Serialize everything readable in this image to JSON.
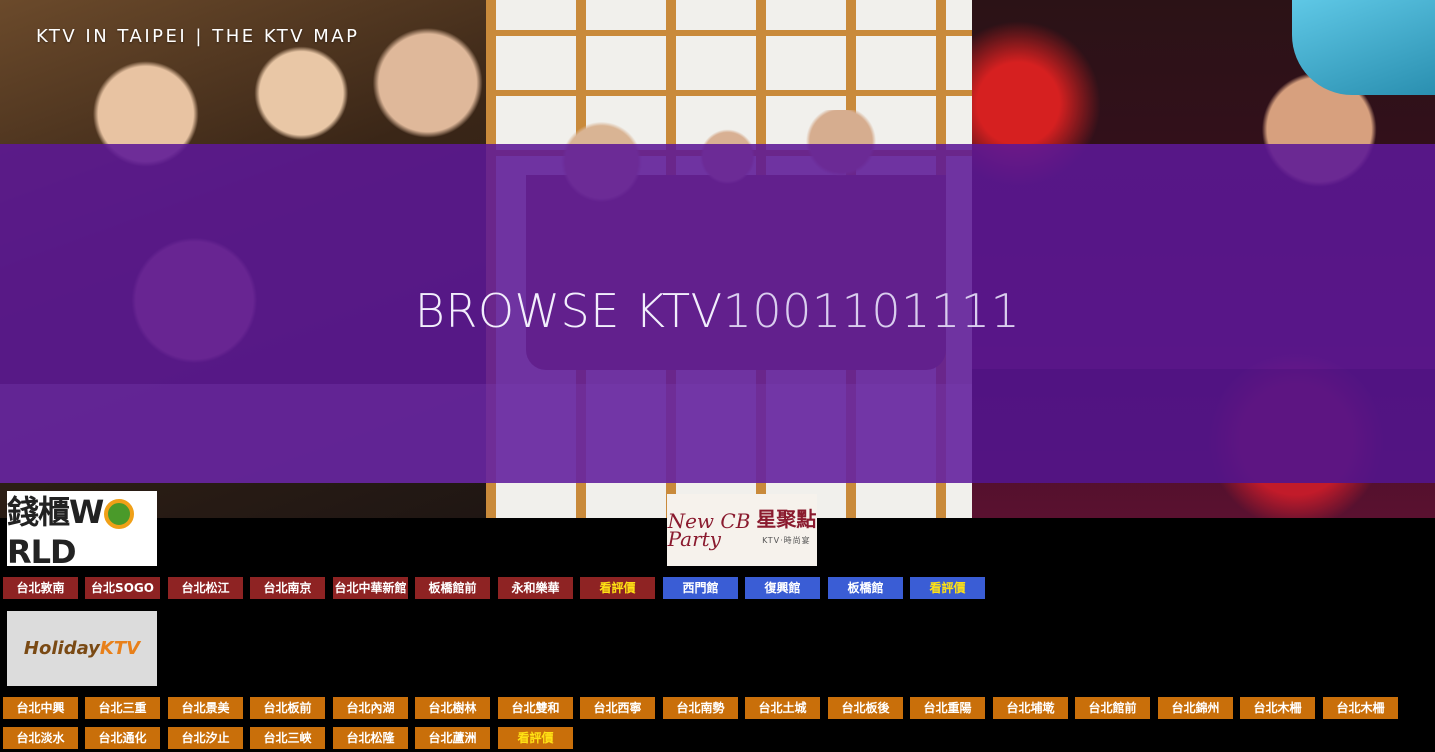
{
  "site": {
    "title": "KTV IN TAIPEI | THE KTV MAP"
  },
  "hero": {
    "browse_word": "BROWSE",
    "browse_ktv": "KTV",
    "browse_number": "1001101111",
    "overlay_color": "#5c1896"
  },
  "brands": {
    "world": {
      "logo_cn": "錢櫃",
      "logo_en_w": "W",
      "logo_en_rld": "RLD",
      "row_color": "#8e2323",
      "branches": [
        "台北敦南",
        "台北SOGO",
        "台北松江",
        "台北南京",
        "台北中華新館",
        "板橋館前",
        "永和樂華"
      ],
      "review": "看評價"
    },
    "party": {
      "logo_script_1": "New CB",
      "logo_script_2": "Party",
      "logo_cn": "星聚點",
      "logo_sub": "KTV·時尚宴",
      "row_color": "#3a5dd5",
      "branches": [
        "西門館",
        "復興館",
        "板橋館"
      ],
      "review": "看評價"
    },
    "holiday": {
      "logo_holiday": "Holiday",
      "logo_ktv": "KTV",
      "row_color": "#c96f0a",
      "branches": [
        "台北中興",
        "台北三重",
        "台北景美",
        "台北板前",
        "台北內湖",
        "台北樹林",
        "台北雙和",
        "台北西寧",
        "台北南勢",
        "台北土城",
        "台北板後",
        "台北重陽",
        "台北埔墘",
        "台北館前",
        "台北錦州",
        "台北木柵",
        "台北木柵",
        "台北淡水",
        "台北通化",
        "台北汐止",
        "台北三峽",
        "台北松隆",
        "台北蘆洲"
      ],
      "review": "看評價",
      "review_color": "#ffe214"
    }
  }
}
